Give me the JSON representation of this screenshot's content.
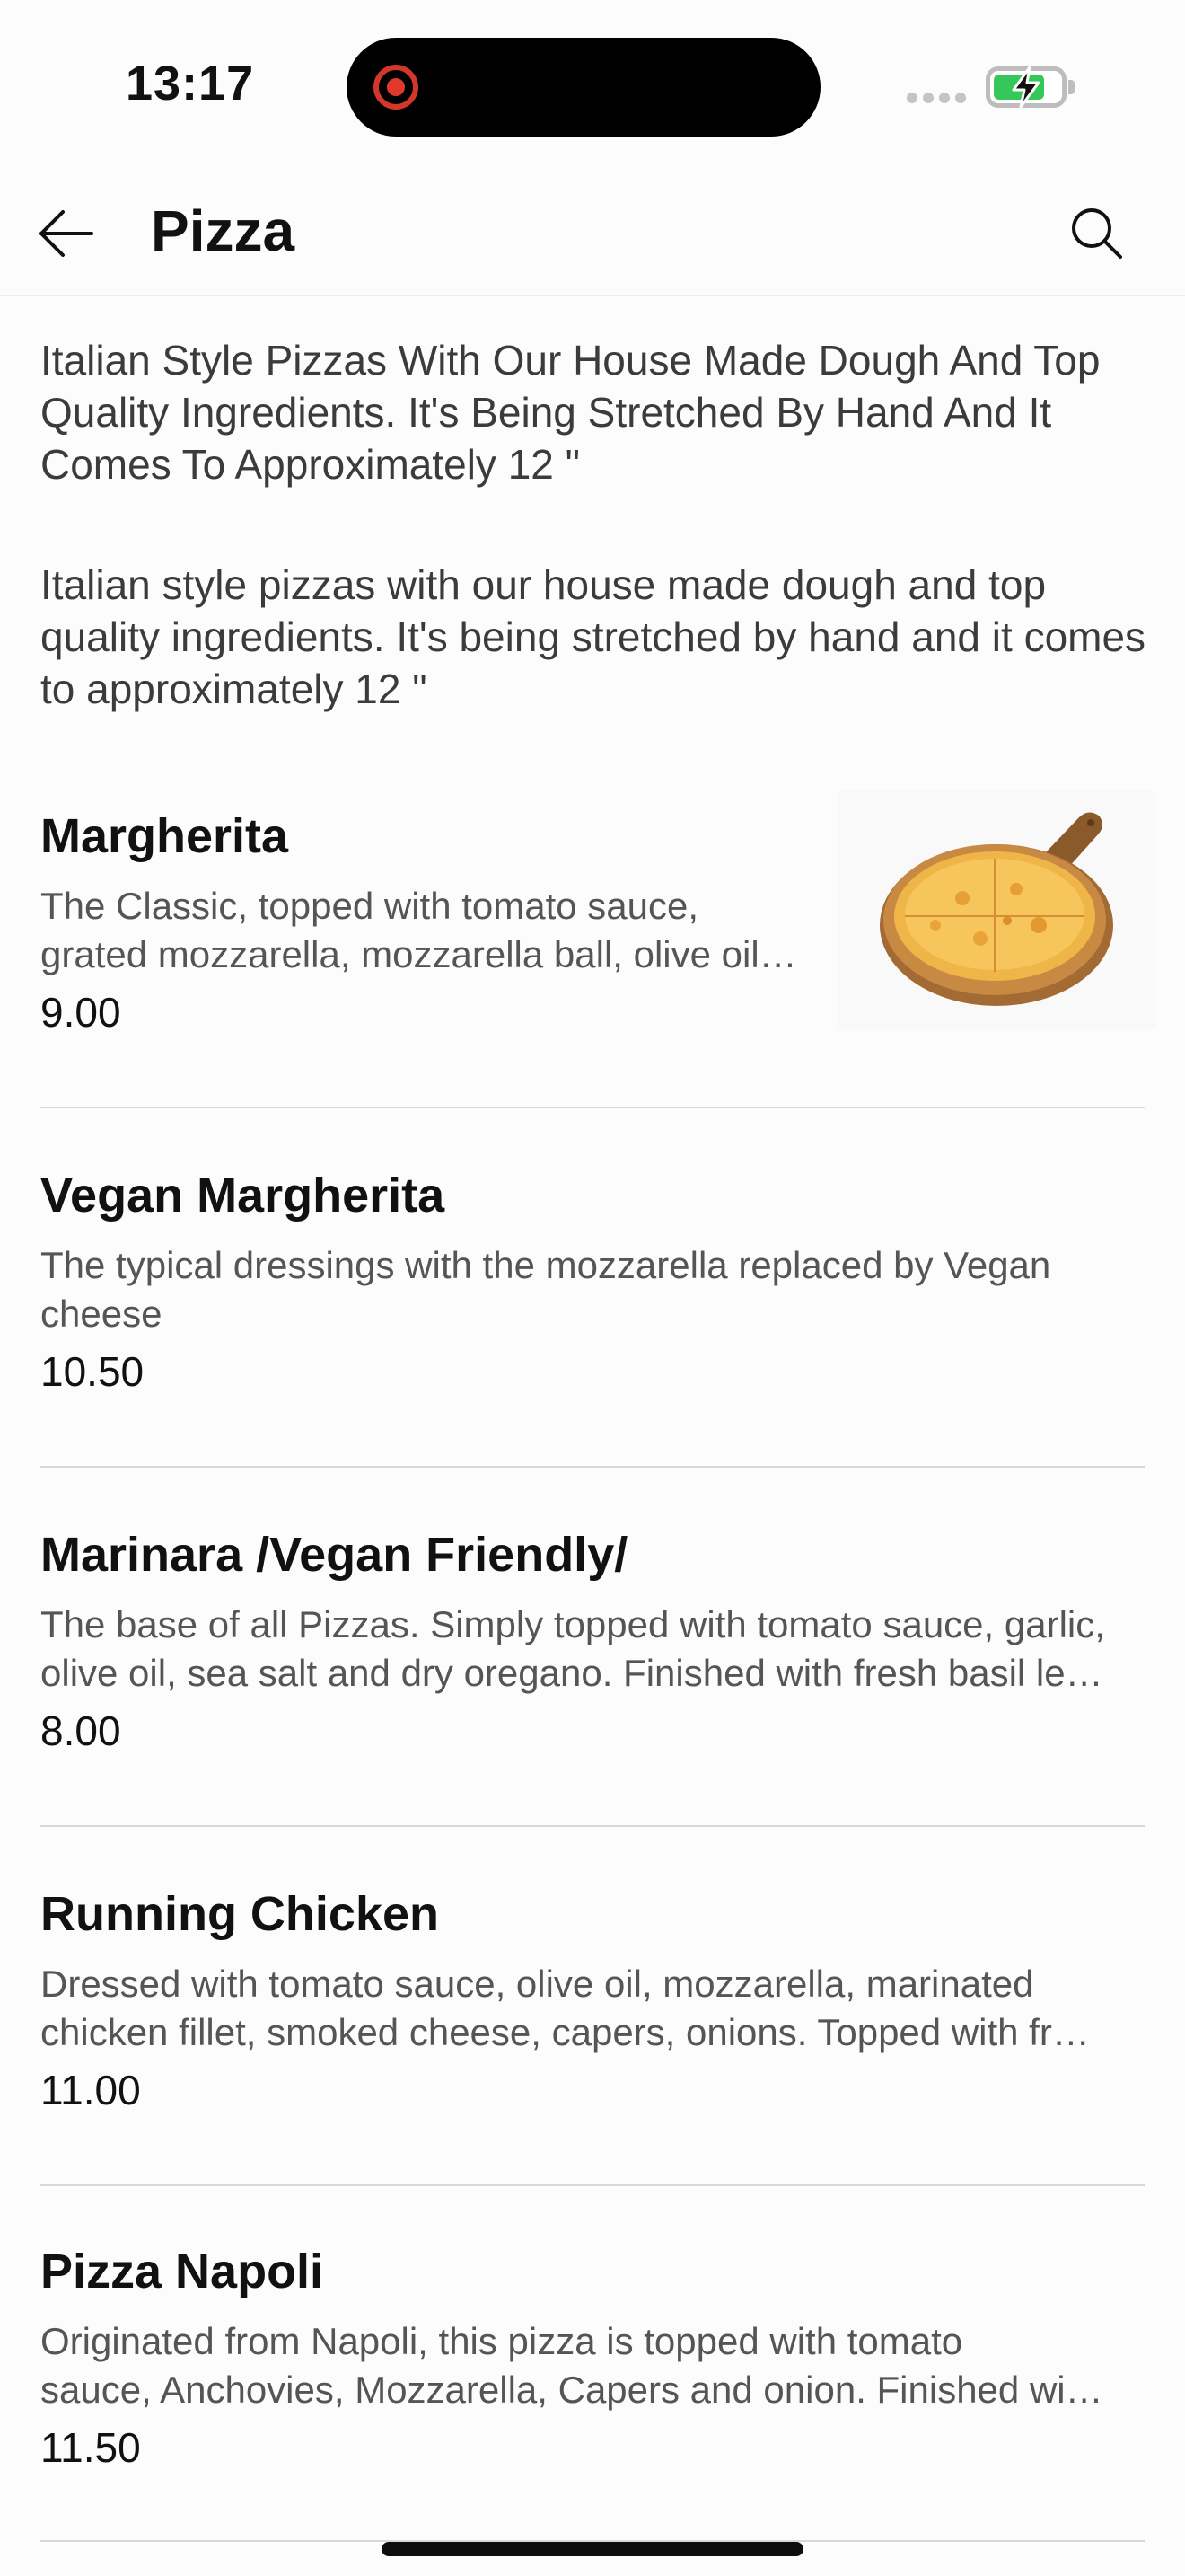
{
  "status_bar": {
    "time": "13:17"
  },
  "header": {
    "title": "Pizza",
    "back_icon": "arrow-left-icon",
    "search_icon": "search-icon"
  },
  "category": {
    "description_title_case": "Italian Style Pizzas With Our House Made Dough And Top Quality Ingredients. It's Being Stretched By Hand And It Comes To Approximately 12 \"",
    "description": "Italian style pizzas with our house made dough and top quality ingredients. It's being stretched by hand and it comes to approximately 12 \""
  },
  "items": [
    {
      "name": "Margherita",
      "description_lines": [
        "The Classic, topped with tomato sauce,",
        "grated mozzarella, mozzarella ball, olive oil…"
      ],
      "price": "9.00",
      "has_image": true
    },
    {
      "name": "Vegan Margherita",
      "description_lines": [
        "The typical dressings with the mozzarella replaced by Vegan",
        "cheese"
      ],
      "price": "10.50",
      "has_image": false
    },
    {
      "name": "Marinara /Vegan Friendly/",
      "description_lines": [
        "The base of all Pizzas. Simply topped with tomato sauce, garlic,",
        "olive oil, sea salt and dry oregano. Finished with fresh basil le…"
      ],
      "price": "8.00",
      "has_image": false
    },
    {
      "name": "Running Chicken",
      "description_lines": [
        "Dressed with tomato sauce, olive oil, mozzarella, marinated",
        "chicken fillet, smoked cheese, capers, onions. Topped with fr…"
      ],
      "price": "11.00",
      "has_image": false
    },
    {
      "name": "Pizza Napoli",
      "description_lines": [
        "Originated from Napoli, this pizza is topped with tomato",
        "sauce, Anchovies, Mozzarella, Capers and onion. Finished wi…"
      ],
      "price": "11.50",
      "has_image": false
    }
  ],
  "colors": {
    "background": "#fcfcfc",
    "text_primary": "#111111",
    "text_secondary": "#555555",
    "divider": "#d8d8d8",
    "battery_green": "#35c759",
    "record_red": "#e0392c"
  }
}
